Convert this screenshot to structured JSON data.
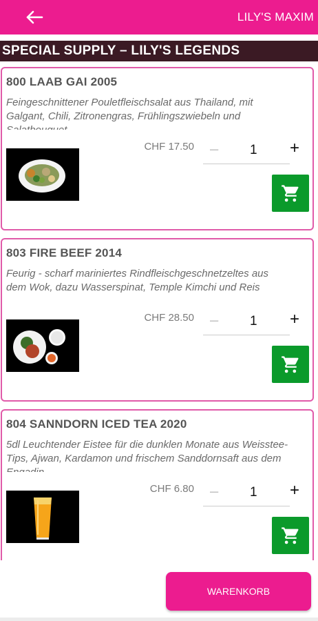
{
  "header": {
    "back_icon": "arrow-left-icon",
    "title": "LILY'S MAXIM",
    "color": "#ec1c8f"
  },
  "section": {
    "title": "SPECIAL SUPPLY – LILY'S LEGENDS",
    "color": "#3b1a24"
  },
  "products": [
    {
      "name": "800 LAAB GAI 2005",
      "description": "Feingeschnittener Pouletfleischsalat aus Thailand, mit Galgant, Chili, Zitronengras, Frühlingszwiebeln und Salatbouquet",
      "price": "CHF 17.50",
      "quantity": "1",
      "image": "salad-plate-image"
    },
    {
      "name": "803 FIRE BEEF 2014",
      "description": "Feurig - scharf mariniertes Rindfleischgeschnetzeltes aus dem Wok, dazu Wasserspinat, Temple Kimchi und Reis",
      "price": "CHF 28.50",
      "quantity": "1",
      "image": "beef-plate-image"
    },
    {
      "name": "804 SANNDORN ICED TEA 2020",
      "description": "5dl Leuchtender Eistee für die dunklen Monate aus Weisstee-Tips, Ajwan, Kardamon und frischem Sanddornsaft aus dem Engadin",
      "price": "CHF 6.80",
      "quantity": "1",
      "image": "iced-tea-glass-image"
    }
  ],
  "stepper": {
    "minus": "–",
    "plus": "+"
  },
  "cart_button_color": "#0b9a2b",
  "footer": {
    "cart_label": "WARENKORB"
  }
}
